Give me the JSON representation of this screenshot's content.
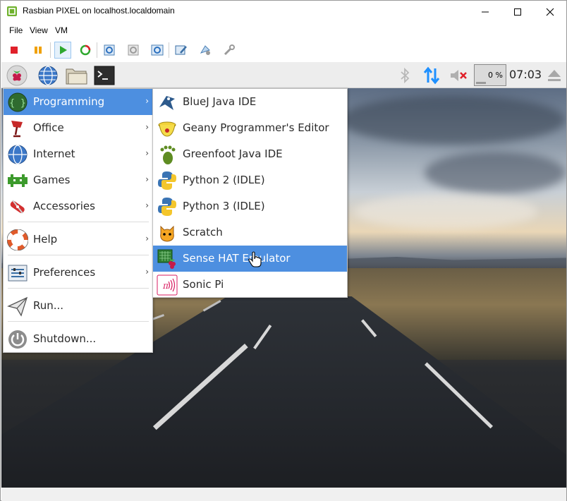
{
  "window": {
    "title": "Rasbian PIXEL on localhost.localdomain",
    "controls": [
      "minimize-icon",
      "maximize-icon",
      "close-icon"
    ]
  },
  "menubar": {
    "items": [
      "File",
      "View",
      "VM"
    ]
  },
  "toolbar": {
    "buttons": [
      "stop-icon",
      "pause-icon",
      "play-icon",
      "reset-icon",
      "snapshot-icon",
      "revert-icon",
      "manage-snapshots-icon",
      "settings-icon",
      "share-icon",
      "tools-icon"
    ]
  },
  "panel": {
    "launchers": [
      "raspberry-menu-icon",
      "web-browser-icon",
      "file-manager-icon",
      "terminal-icon"
    ],
    "cpu_usage": "0 %",
    "clock": "07:03",
    "tray": [
      "bluetooth-icon",
      "network-icon",
      "volume-muted-icon",
      "eject-icon"
    ]
  },
  "main_menu": {
    "items": [
      {
        "label": "Programming",
        "icon": "programming-icon",
        "submenu": true
      },
      {
        "label": "Office",
        "icon": "office-icon",
        "submenu": true
      },
      {
        "label": "Internet",
        "icon": "internet-icon",
        "submenu": true
      },
      {
        "label": "Games",
        "icon": "games-icon",
        "submenu": true
      },
      {
        "label": "Accessories",
        "icon": "accessories-icon",
        "submenu": true
      },
      {
        "label": "Help",
        "icon": "help-icon",
        "submenu": true
      },
      {
        "label": "Preferences",
        "icon": "preferences-icon",
        "submenu": true
      },
      {
        "label": "Run...",
        "icon": "run-icon",
        "submenu": false
      },
      {
        "label": "Shutdown...",
        "icon": "shutdown-icon",
        "submenu": false
      }
    ]
  },
  "sub_menu": {
    "items": [
      {
        "label": "BlueJ Java IDE",
        "icon": "bluej-icon"
      },
      {
        "label": "Geany Programmer's Editor",
        "icon": "geany-icon"
      },
      {
        "label": "Greenfoot Java IDE",
        "icon": "greenfoot-icon"
      },
      {
        "label": "Python 2 (IDLE)",
        "icon": "python-icon"
      },
      {
        "label": "Python 3 (IDLE)",
        "icon": "python-icon"
      },
      {
        "label": "Scratch",
        "icon": "scratch-icon"
      },
      {
        "label": "Sense HAT Emulator",
        "icon": "sense-hat-icon"
      },
      {
        "label": "Sonic Pi",
        "icon": "sonic-pi-icon"
      }
    ]
  },
  "colors": {
    "highlight": "#4d8fe0",
    "panel": "#ededed",
    "network": "#1e90ff"
  }
}
